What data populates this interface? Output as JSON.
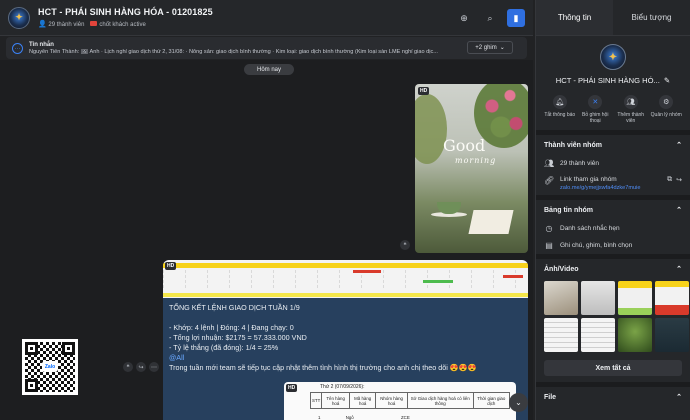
{
  "header": {
    "title": "HCT - PHÁI SINH HÀNG HÓA - 01201825",
    "members": "29 thành viên",
    "status": "chốt khách active"
  },
  "pinned": {
    "label": "Tin nhắn",
    "message": "Nguyễn Tiến Thành: 🖼 Ảnh · Lịch nghỉ giao dịch thứ 2, 31/08: · Nông sản: giao dịch bình thường · Kim loại: giao dịch bình thường (Kim loại sàn LME nghỉ giao dịc...",
    "more": "+2 ghim"
  },
  "chat": {
    "date_chip": "Hôm nay",
    "message_lines": [
      "TỔNG KẾT LỆNH GIAO DỊCH TUẦN 1/9",
      "",
      "- Khớp: 4 lệnh | Đóng: 4 | Đang chạy: 0",
      "- Tổng lợi nhuận: $2175 = 57.333.000 VND",
      "- Tỷ lệ thắng (đã đóng): 1/4 = 25%"
    ],
    "mention": "@All",
    "closing": "Trong tuần mới team sẽ tiếp tục cập nhật thêm tình hình thị trường cho anh chị theo dõi 😍😍😍",
    "photo_text_big": "Good",
    "photo_text_small": "morning",
    "hd_badge": "HD",
    "qr_logo": "Zalo",
    "doc_title": "Thứ 2 (07/09/2026):",
    "doc_headers": [
      "STT",
      "Tên hàng hoá",
      "Mã hàng hoá",
      "Nhóm hàng hoá",
      "Sở Giao dịch hàng hoá có liên thông",
      "Thời gian giao dịch"
    ],
    "doc_row": [
      "1",
      "Ngô",
      "ZCE"
    ]
  },
  "panel": {
    "tabs": [
      "Thông tin",
      "Biểu tượng"
    ],
    "group_name": "HCT - PHÁI SINH HÀNG HÓ...",
    "actions": [
      {
        "label": "Tắt thông báo",
        "icon": "bell-icon"
      },
      {
        "label": "Bỏ ghim hội thoại",
        "icon": "pin-icon"
      },
      {
        "label": "Thêm thành viên",
        "icon": "add-member-icon"
      },
      {
        "label": "Quản lý nhóm",
        "icon": "gear-icon"
      }
    ],
    "members_section": "Thành viên nhóm",
    "members_count": "29 thành viên",
    "join_link_label": "Link tham gia nhóm",
    "join_link": "zalo.me/g/ymejjswfa4dzke7muie",
    "board_section": "Bảng tin nhóm",
    "reminders": "Danh sách nhắc hẹn",
    "notes": "Ghi chú, ghim, bình chọn",
    "media_section": "Ảnh/Video",
    "see_all": "Xem tất cả",
    "file_section": "File"
  }
}
